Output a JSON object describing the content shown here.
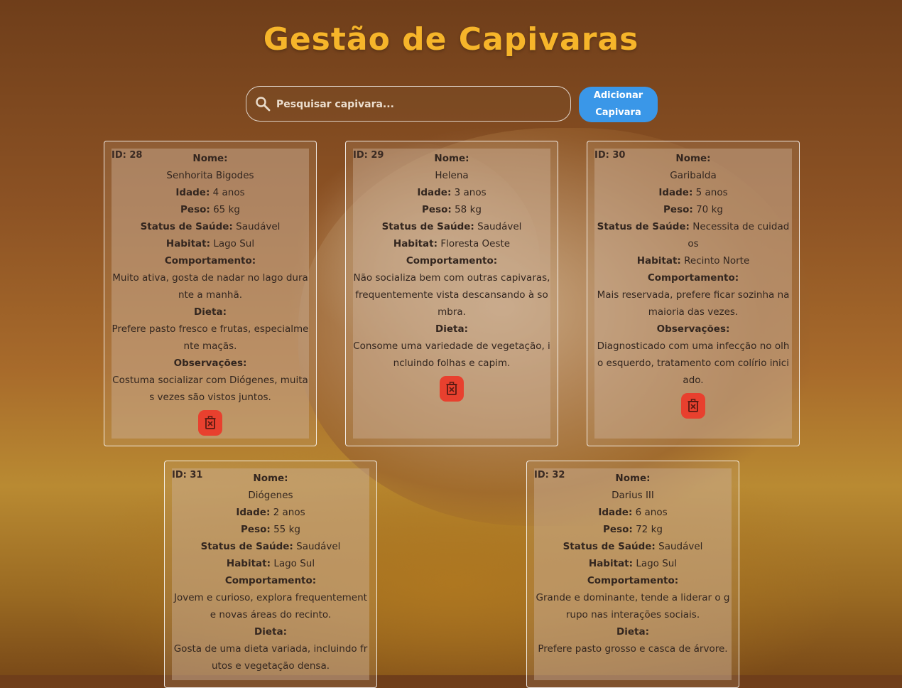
{
  "header": {
    "title": "Gestão de Capivaras"
  },
  "search": {
    "placeholder": "Pesquisar capivara..."
  },
  "toolbar": {
    "add_label": "Adicionar Capivara"
  },
  "labels": {
    "id": "ID:",
    "nome": "Nome:",
    "idade": "Idade:",
    "peso": "Peso:",
    "status": "Status de Saúde:",
    "habitat": "Habitat:",
    "comportamento": "Comportamento:",
    "dieta": "Dieta:",
    "observacoes": "Observações:"
  },
  "icons": {
    "search": "search-icon",
    "delete": "trash-icon"
  },
  "colors": {
    "title": "#f6b52a",
    "add_button": "#3a97e8",
    "delete_button": "#e8402e"
  },
  "capybaras": [
    {
      "id": "28",
      "nome": "Senhorita Bigodes",
      "idade": "4 anos",
      "peso": "65 kg",
      "status": "Saudável",
      "habitat": "Lago Sul",
      "comportamento": "Muito ativa, gosta de nadar no lago durante a manhã.",
      "dieta": "Prefere pasto fresco e frutas, especialmente maçãs.",
      "observacoes": "Costuma socializar com Diógenes, muitas vezes são vistos juntos."
    },
    {
      "id": "29",
      "nome": "Helena",
      "idade": "3 anos",
      "peso": "58 kg",
      "status": "Saudável",
      "habitat": "Floresta Oeste",
      "comportamento": "Não socializa bem com outras capivaras, frequentemente vista descansando à sombra.",
      "dieta": "Consome uma variedade de vegetação, incluindo folhas e capim."
    },
    {
      "id": "30",
      "nome": "Garibalda",
      "idade": "5 anos",
      "peso": "70 kg",
      "status": "Necessita de cuidados",
      "habitat": "Recinto Norte",
      "comportamento": "Mais reservada, prefere ficar sozinha na maioria das vezes.",
      "observacoes": "Diagnosticado com uma infecção no olho esquerdo, tratamento com colírio iniciado."
    },
    {
      "id": "31",
      "nome": "Diógenes",
      "idade": "2 anos",
      "peso": "55 kg",
      "status": "Saudável",
      "habitat": "Lago Sul",
      "comportamento": "Jovem e curioso, explora frequentemente novas áreas do recinto.",
      "dieta": "Gosta de uma dieta variada, incluindo frutos e vegetação densa."
    },
    {
      "id": "32",
      "nome": "Darius III",
      "idade": "6 anos",
      "peso": "72 kg",
      "status": "Saudável",
      "habitat": "Lago Sul",
      "comportamento": "Grande e dominante, tende a liderar o grupo nas interações sociais.",
      "dieta": "Prefere pasto grosso e casca de árvore."
    }
  ]
}
